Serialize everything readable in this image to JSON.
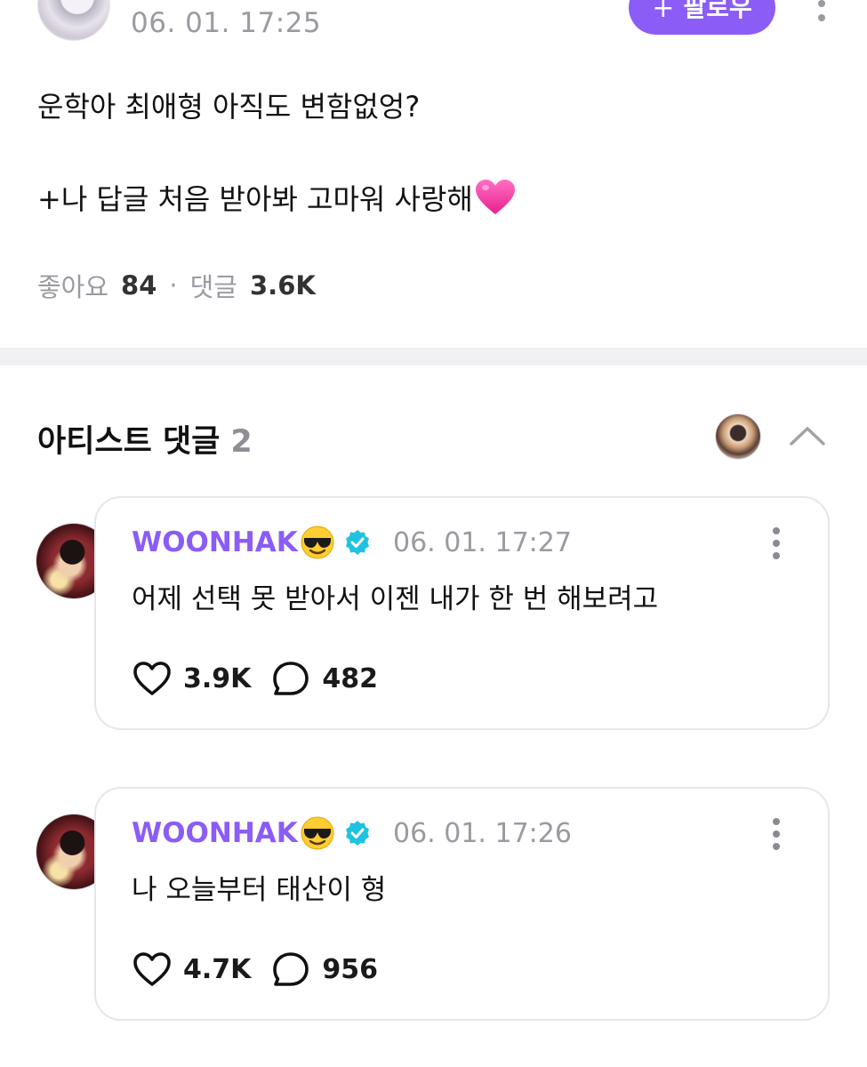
{
  "post": {
    "time": "06. 01. 17:25",
    "follow_label": "팔로우",
    "follow_plus": "+",
    "line1": "운학아 최애형 아직도 변함없엉?",
    "line2": "+나 답글 처음 받아봐 고마워 사랑해",
    "heart_emoji": "pink-heart-icon",
    "likes_label": "좋아요",
    "likes_count": "84",
    "separator": "·",
    "comments_label": "댓글",
    "comments_count": "3.6K"
  },
  "artist_comments": {
    "title": "아티스트 댓글",
    "count": "2",
    "comments": [
      {
        "name": "WOONHAK",
        "emoji": "sunglasses-emoji",
        "time": "06. 01. 17:27",
        "text": "어제 선택 못 받아서 이젠 내가 한 번 해보려고",
        "likes": "3.9K",
        "replies": "482"
      },
      {
        "name": "WOONHAK",
        "emoji": "sunglasses-emoji",
        "time": "06. 01. 17:26",
        "text": "나 오늘부터 태산이 형",
        "likes": "4.7K",
        "replies": "956"
      }
    ]
  },
  "colors": {
    "accent": "#8b5cf6",
    "verified": "#1fc3e0",
    "muted": "#9a9aa1"
  }
}
